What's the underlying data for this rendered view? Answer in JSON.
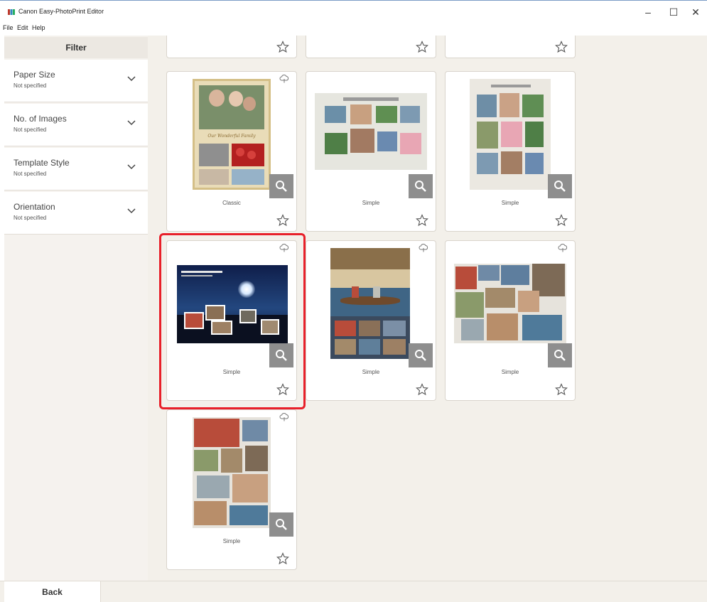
{
  "window": {
    "title": "Canon Easy-PhotoPrint Editor",
    "minimize": "–",
    "maximize": "☐",
    "close": "✕"
  },
  "menu": [
    "File",
    "Edit",
    "Help"
  ],
  "sidebar": {
    "header": "Filter",
    "filters": [
      {
        "label": "Paper Size",
        "value": "Not specified"
      },
      {
        "label": "No. of Images",
        "value": "Not specified"
      },
      {
        "label": "Template Style",
        "value": "Not specified"
      },
      {
        "label": "Orientation",
        "value": "Not specified"
      }
    ]
  },
  "templates": [
    {
      "style": "Classic",
      "selected": false,
      "favorite": false
    },
    {
      "style": "Simple",
      "selected": false,
      "favorite": false
    },
    {
      "style": "Simple",
      "selected": false,
      "favorite": false
    },
    {
      "style": "Simple",
      "selected": true,
      "favorite": false
    },
    {
      "style": "Simple",
      "selected": false,
      "favorite": false
    },
    {
      "style": "Simple",
      "selected": false,
      "favorite": false
    },
    {
      "style": "Simple",
      "selected": false,
      "favorite": false
    }
  ],
  "thumbnail_texts": {
    "classic_banner": "Our Wonderful Family"
  },
  "footer": {
    "back_label": "Back"
  },
  "colors": {
    "selection_border": "#e8202a",
    "sidebar_bg": "#f5f2ee",
    "main_bg": "#f3f0ea",
    "zoom_button": "#8e8e8e"
  },
  "icons": {
    "star": "star-icon",
    "cloud": "cloud-download-icon",
    "zoom": "magnifier-icon",
    "chevron": "chevron-down-icon"
  }
}
